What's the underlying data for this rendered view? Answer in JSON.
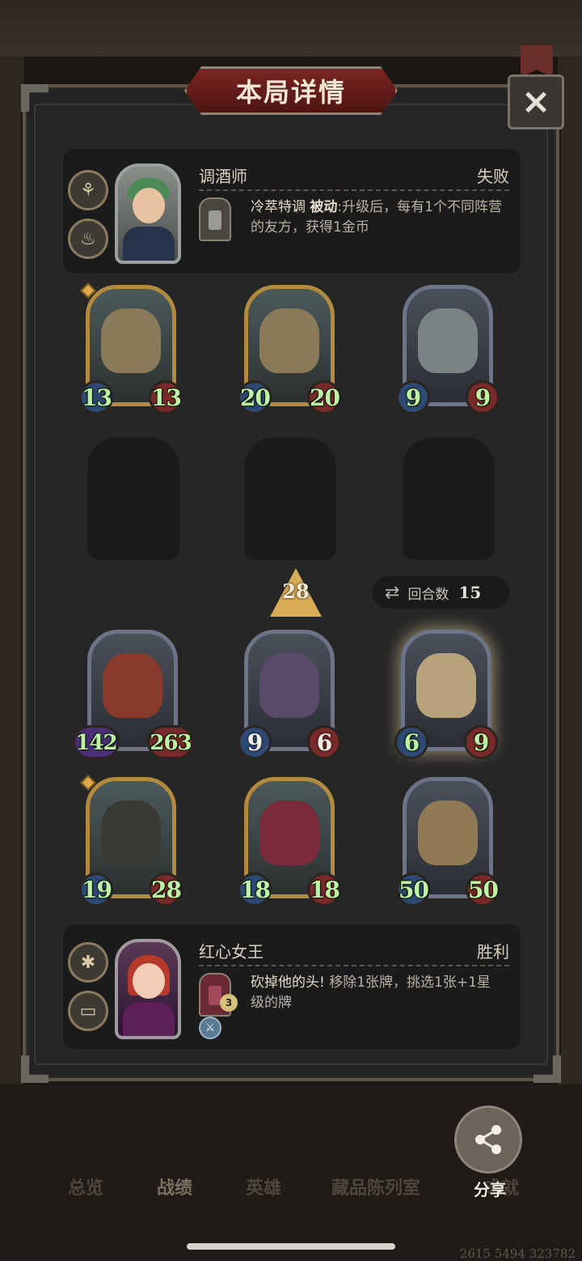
{
  "header": {
    "title": "本局详情",
    "close_icon": "×"
  },
  "top_player": {
    "hero_name": "调酒师",
    "result": "失败",
    "side_icons": [
      "fan-icon",
      "lamp-icon"
    ],
    "skill_name": "冷萃特调",
    "skill_type": "被动",
    "skill_desc": ":升级后，每有1个不同阵营的友方，获得1金币"
  },
  "opponent_board": [
    {
      "name": "drill-minion",
      "atk": "13",
      "hp": "13"
    },
    {
      "name": "drill-minion",
      "atk": "20",
      "hp": "20"
    },
    {
      "name": "robot-minion",
      "atk": "9",
      "hp": "9"
    }
  ],
  "tier": "28",
  "round": {
    "label": "回合数",
    "value": "15"
  },
  "player_board_row1": [
    {
      "name": "hooded-assassin-minion",
      "atk": "142",
      "hp": "263"
    },
    {
      "name": "demon-lady-minion",
      "atk": "9",
      "hp": "6"
    },
    {
      "name": "goggles-kid-minion",
      "atk": "6",
      "hp": "9"
    }
  ],
  "player_board_row2": [
    {
      "name": "pirate-ship-minion",
      "atk": "19",
      "hp": "28"
    },
    {
      "name": "clown-minion",
      "atk": "18",
      "hp": "18"
    },
    {
      "name": "clock-minion",
      "atk": "50",
      "hp": "50"
    }
  ],
  "bottom_player": {
    "hero_name": "红心女王",
    "result": "胜利",
    "side_icons": [
      "gift-icon",
      "coffin-icon"
    ],
    "skill_name": "砍掉他的头!",
    "skill_desc": "移除1张牌，挑选1张+1星级的牌",
    "skill_level": "3"
  },
  "tabs": [
    "总览",
    "战绩",
    "英雄",
    "藏品陈列室",
    "成就"
  ],
  "share_label": "分享",
  "uid": "2615 5494 323782",
  "colors": {
    "attack": "#2e4a73",
    "health": "#7b2a2a",
    "stat_text": "#bff2a4",
    "banner": "#7a2521"
  }
}
